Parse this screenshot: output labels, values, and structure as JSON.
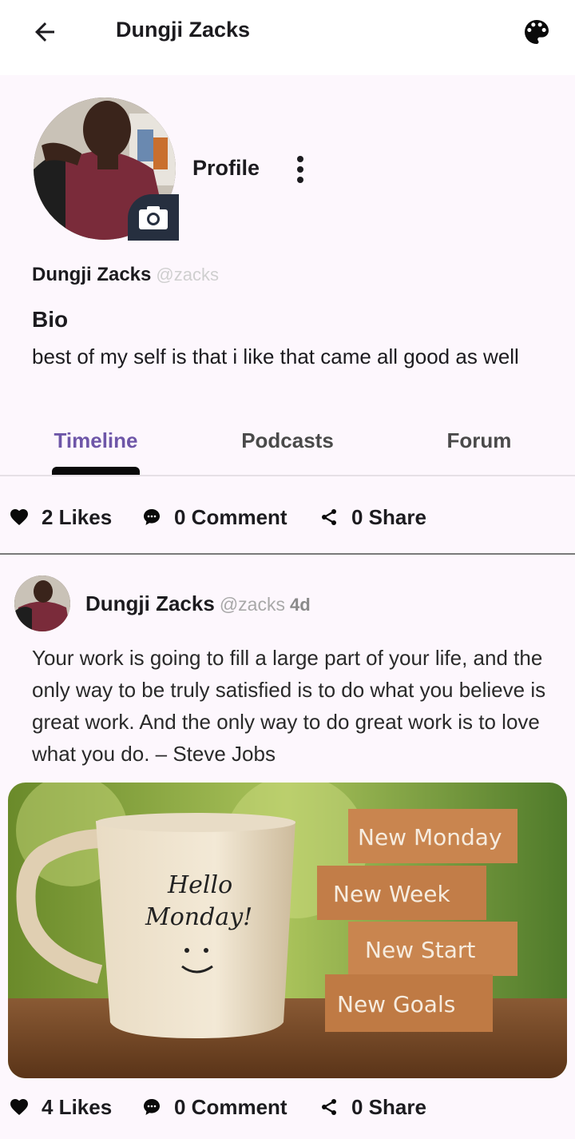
{
  "appbar": {
    "title": "Dungji Zacks"
  },
  "profile": {
    "label": "Profile",
    "name": "Dungji Zacks",
    "handle": "@zacks",
    "bio_title": "Bio",
    "bio_text": "best of my self is that i like that came all good as well"
  },
  "tabs": [
    {
      "label": "Timeline",
      "active": true
    },
    {
      "label": "Podcasts",
      "active": false
    },
    {
      "label": "Forum",
      "active": false
    }
  ],
  "profile_stats": {
    "likes": "2 Likes",
    "comments": "0 Comment",
    "shares": "0 Share"
  },
  "post": {
    "author": "Dungji Zacks",
    "handle": "@zacks",
    "time": "4d",
    "text": "Your work is going to fill a large part of your life, and the only way to be truly satisfied is to do what you believe is great work. And the only way to do great work is to love what you do. – Steve Jobs",
    "image": {
      "mug_text_1": "Hello",
      "mug_text_2": "Monday!",
      "blocks": [
        "New Monday",
        "New Week",
        "New Start",
        "New Goals"
      ]
    },
    "stats": {
      "likes": "4 Likes",
      "comments": "0 Comment",
      "shares": "0 Share"
    }
  },
  "colors": {
    "accent": "#6e56a8",
    "background": "#fdf7fd",
    "camera_badge": "#262f3f"
  }
}
